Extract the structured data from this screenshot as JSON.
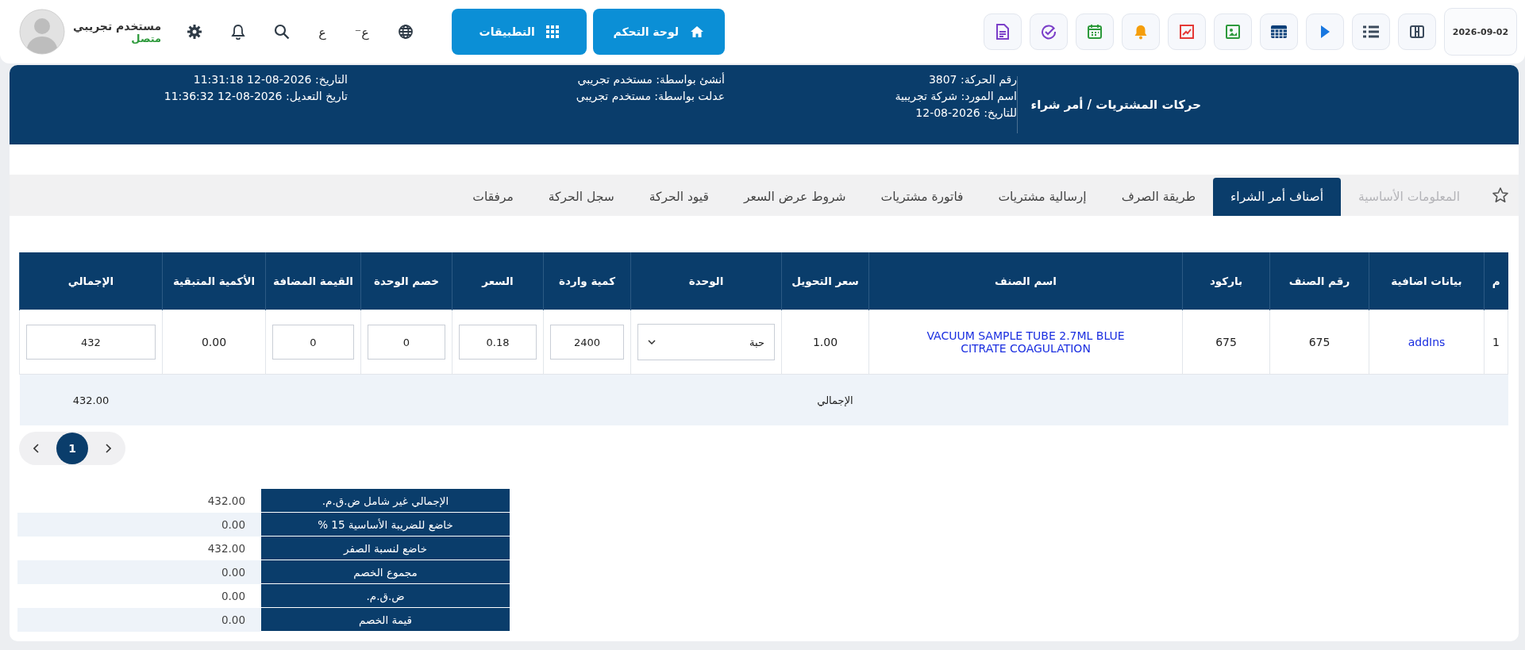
{
  "top_bar": {
    "date": "2026-09-02",
    "buttons": [
      {
        "label": "لوحة التحكم",
        "kind": "home"
      },
      {
        "label": "التطبيقات",
        "kind": "apps"
      }
    ],
    "font_toggles": [
      "ع⁻",
      "ع"
    ],
    "user": {
      "name": "مستخدم تجريبي",
      "status": "متصل"
    }
  },
  "header": {
    "title": "حركات المشتريات / أمر شراء",
    "columns": [
      [
        "رقم الحركة: 3807",
        "اسم المورد: شركة تجريبية",
        "للتاريخ: 2026-08-12"
      ],
      [
        "أنشئ بواسطة: مستخدم تجريبي",
        "عدلت بواسطة: مستخدم تجريبي"
      ],
      [
        "التاريخ: 2026-08-12 11:31:18",
        "تاريخ التعديل: 2026-08-12 11:36:32"
      ]
    ]
  },
  "tabs": [
    {
      "label": "المعلومات الأساسية",
      "selected": false,
      "disabled": true
    },
    {
      "label": "أصناف أمر الشراء",
      "selected": true,
      "disabled": false
    },
    {
      "label": "طريقة الصرف",
      "selected": false,
      "disabled": false
    },
    {
      "label": "إرسالية مشتريات",
      "selected": false,
      "disabled": false
    },
    {
      "label": "فاتورة مشتريات",
      "selected": false,
      "disabled": false
    },
    {
      "label": "شروط عرض السعر",
      "selected": false,
      "disabled": false
    },
    {
      "label": "قيود الحركة",
      "selected": false,
      "disabled": false
    },
    {
      "label": "سجل الحركة",
      "selected": false,
      "disabled": false
    },
    {
      "label": "مرفقات",
      "selected": false,
      "disabled": false
    }
  ],
  "table": {
    "columns": [
      "م",
      "بيانات اضافية",
      "رقم الصنف",
      "باركود",
      "اسم الصنف",
      "سعر التحويل",
      "الوحدة",
      "كمية واردة",
      "السعر",
      "خصم الوحدة",
      "القيمة المضافة",
      "الأكمية المتبقية",
      "الإجمالي"
    ],
    "rows": [
      {
        "cells": [
          {
            "kind": "text",
            "value": "1"
          },
          {
            "kind": "link",
            "value": "addIns"
          },
          {
            "kind": "text",
            "value": "675"
          },
          {
            "kind": "text",
            "value": "675"
          },
          {
            "kind": "link",
            "value": "VACUUM SAMPLE TUBE 2.7ML BLUE CITRATE COAGULATION"
          },
          {
            "kind": "text",
            "value": "1.00"
          },
          {
            "kind": "select",
            "value": "حبة"
          },
          {
            "kind": "input",
            "value": "2400"
          },
          {
            "kind": "input",
            "value": "0.18"
          },
          {
            "kind": "input",
            "value": "0"
          },
          {
            "kind": "input",
            "value": "0"
          },
          {
            "kind": "text",
            "value": "0.00"
          },
          {
            "kind": "input",
            "value": "432"
          }
        ]
      }
    ],
    "footer": {
      "label": "الإجمالي",
      "total": "432.00"
    }
  },
  "pagination": {
    "pages": [
      {
        "label": "1",
        "selected": true
      }
    ]
  },
  "summary": [
    {
      "label": "الإجمالي غير شامل ض.ق.م.",
      "value": "432.00"
    },
    {
      "label": "خاضع للضريبة الأساسية 15 %",
      "value": "0.00"
    },
    {
      "label": "خاضع لنسبة الصفر",
      "value": "432.00"
    },
    {
      "label": "مجموع الخصم",
      "value": "0.00"
    },
    {
      "label": "ض.ق.م.",
      "value": "0.00"
    },
    {
      "label": "قيمة الخصم",
      "value": "0.00"
    }
  ]
}
